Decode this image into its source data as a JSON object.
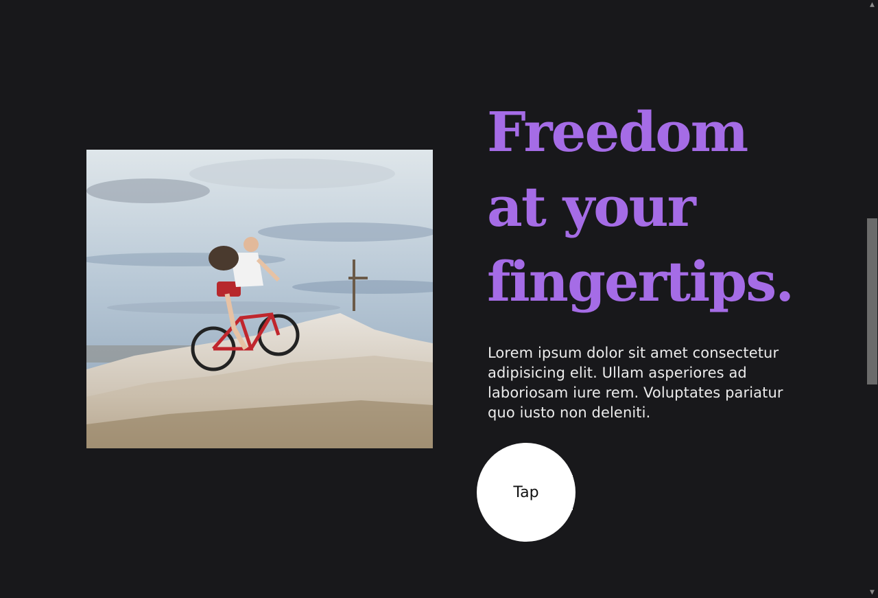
{
  "hero": {
    "image_alt": "Mountain biker riding up a rocky summit toward a wooden cross under a cloudy sky"
  },
  "headline": {
    "lines": [
      "Freedom",
      "at your",
      "fingertips."
    ],
    "color": "#a56ce6"
  },
  "body": {
    "text": "Lorem ipsum dolor sit amet consectetur adipisicing elit. Ullam asperiores ad laboriosam iure rem. Voluptates pariatur quo iusto non deleniti."
  },
  "cta": {
    "label": "Tap"
  },
  "scrollbar": {
    "up_icon": "chevron-up-icon",
    "down_icon": "chevron-down-icon"
  },
  "colors": {
    "background": "#18181b",
    "accent": "#a56ce6",
    "text": "#ececec"
  }
}
